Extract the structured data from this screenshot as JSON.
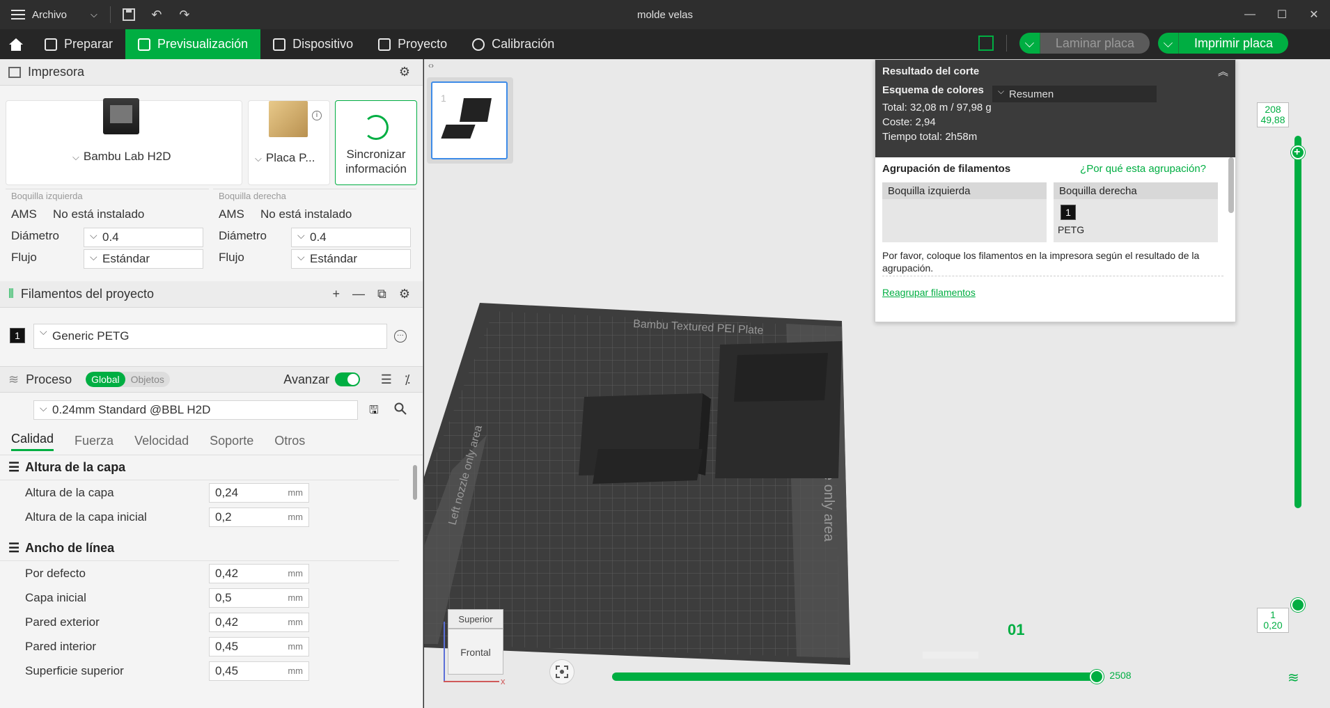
{
  "window": {
    "menu_label": "Archivo",
    "title": "molde velas"
  },
  "nav": {
    "tabs": [
      {
        "label": "Preparar"
      },
      {
        "label": "Previsualización"
      },
      {
        "label": "Dispositivo"
      },
      {
        "label": "Proyecto"
      },
      {
        "label": "Calibración"
      }
    ],
    "laminar_label": "Laminar placa",
    "imprimir_label": "Imprimir placa"
  },
  "printer": {
    "section_title": "Impresora",
    "printer_name": "Bambu Lab H2D",
    "plate_name": "Placa P...",
    "sync_label": "Sincronizar información",
    "left_nozzle": {
      "title": "Boquilla izquierda",
      "ams_label": "AMS",
      "ams_value": "No está instalado",
      "diameter_label": "Diámetro",
      "diameter_value": "0.4",
      "flow_label": "Flujo",
      "flow_value": "Estándar"
    },
    "right_nozzle": {
      "title": "Boquilla derecha",
      "ams_label": "AMS",
      "ams_value": "No está instalado",
      "diameter_label": "Diámetro",
      "diameter_value": "0.4",
      "flow_label": "Flujo",
      "flow_value": "Estándar"
    }
  },
  "filaments": {
    "section_title": "Filamentos del proyecto",
    "items": [
      {
        "index": "1",
        "name": "Generic PETG"
      }
    ]
  },
  "process": {
    "section_title": "Proceso",
    "scope_global": "Global",
    "scope_objects": "Objetos",
    "advanced_label": "Avanzar",
    "profile": "0.24mm Standard @BBL H2D",
    "tabs": [
      "Calidad",
      "Fuerza",
      "Velocidad",
      "Soporte",
      "Otros"
    ],
    "groups": [
      {
        "title": "Altura de la capa",
        "rows": [
          {
            "name": "Altura de la capa",
            "value": "0,24",
            "unit": "mm"
          },
          {
            "name": "Altura de la capa inicial",
            "value": "0,2",
            "unit": "mm"
          }
        ]
      },
      {
        "title": "Ancho de línea",
        "rows": [
          {
            "name": "Por defecto",
            "value": "0,42",
            "unit": "mm"
          },
          {
            "name": "Capa inicial",
            "value": "0,5",
            "unit": "mm"
          },
          {
            "name": "Pared exterior",
            "value": "0,42",
            "unit": "mm"
          },
          {
            "name": "Pared interior",
            "value": "0,45",
            "unit": "mm"
          },
          {
            "name": "Superficie superior",
            "value": "0,45",
            "unit": "mm"
          }
        ]
      }
    ]
  },
  "preview": {
    "plate_thumb_number": "1",
    "plate_label": "Bambu Textured PEI Plate",
    "left_area_label": "Left nozzle only area",
    "right_area_label": "Right nozzle only area",
    "plate_number": "01",
    "cube_top": "Superior",
    "cube_front": "Frontal",
    "axis_x": "x",
    "top_layer": {
      "value": "208",
      "height": "49,88"
    },
    "bottom_layer": {
      "value": "1",
      "height": "0,20"
    },
    "move_count": "2508"
  },
  "slice_result": {
    "title": "Resultado del corte",
    "scheme_label": "Esquema de colores",
    "scheme_value": "Resumen",
    "total_label": "Total:",
    "total_value": "32,08 m / 97,98 g",
    "cost_label": "Coste:",
    "cost_value": "2,94",
    "time_label": "Tiempo total:",
    "time_value": "2h58m",
    "grouping_title": "Agrupación de filamentos",
    "grouping_link": "¿Por qué esta agrupación?",
    "left_nozzle": "Boquilla izquierda",
    "right_nozzle": "Boquilla derecha",
    "right_filament_index": "1",
    "right_filament_type": "PETG",
    "note": "Por favor, coloque los filamentos en la impresora según el resultado de la agrupación.",
    "regroup_link": "Reagrupar filamentos"
  },
  "colors": {
    "accent": "#00ae42",
    "titlebar": "#2e2e2e",
    "panel": "#f4f4f4",
    "viewport": "#e9e9e9"
  }
}
